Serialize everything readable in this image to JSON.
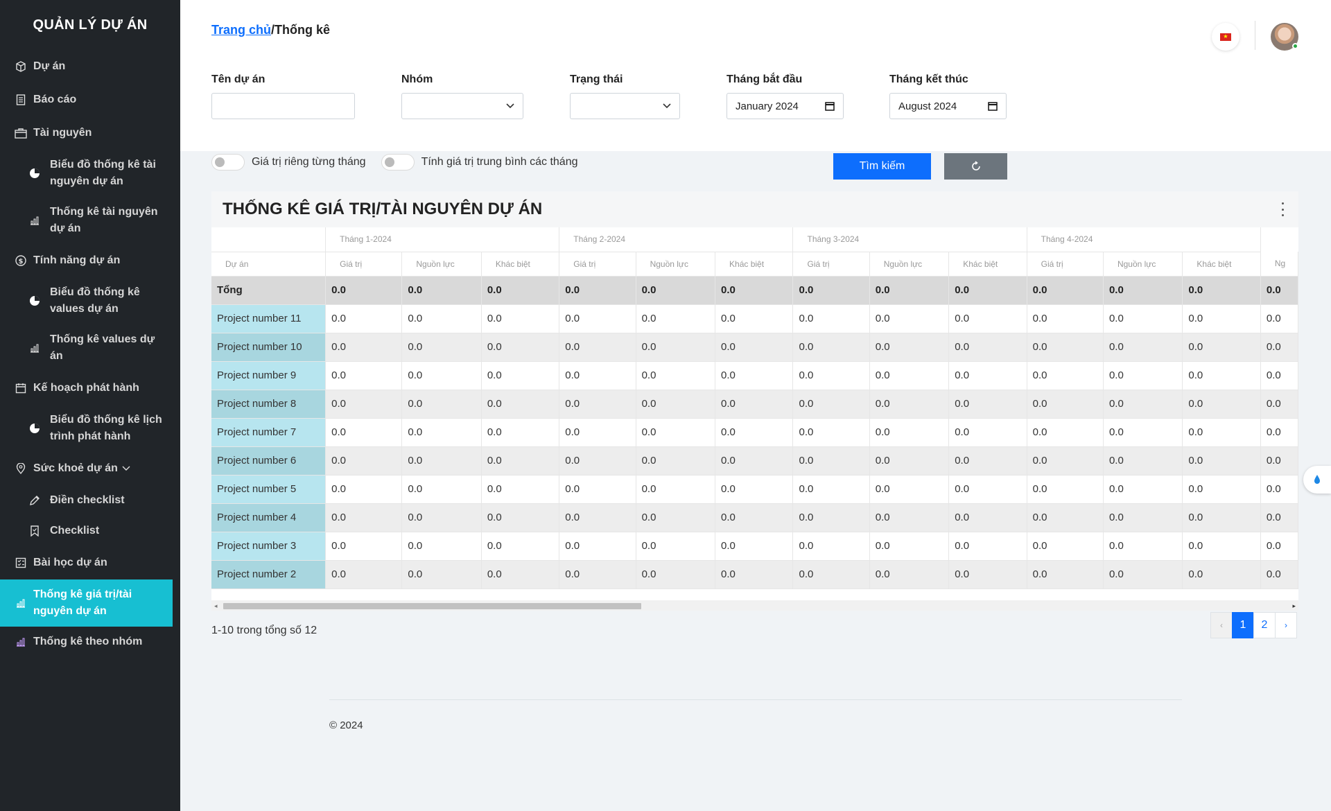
{
  "sidebar": {
    "brand": "QUẢN LÝ DỰ ÁN",
    "items": [
      {
        "label": "Dự án",
        "icon": "cube-icon"
      },
      {
        "label": "Báo cáo",
        "icon": "document-icon"
      },
      {
        "label": "Tài nguyên",
        "icon": "box-icon"
      },
      {
        "label": "Biểu đồ thống kê tài nguyên dự án",
        "icon": "pie-chart-icon"
      },
      {
        "label": "Thống kê tài nguyên dự án",
        "icon": "bar-chart-icon"
      },
      {
        "label": "Tính năng dự án",
        "icon": "dollar-circle-icon"
      },
      {
        "label": "Biểu đồ thống kê values dự án",
        "icon": "pie-chart-icon"
      },
      {
        "label": "Thống kê values dự án",
        "icon": "bar-chart-icon"
      },
      {
        "label": "Kế hoạch phát hành",
        "icon": "calendar-icon"
      },
      {
        "label": "Biểu đồ thống kê lịch trình phát hành",
        "icon": "pie-chart-icon"
      },
      {
        "label": "Sức khoẻ dự án",
        "icon": "location-pin-icon"
      },
      {
        "label": "Điền checklist",
        "icon": "pencil-icon"
      },
      {
        "label": "Checklist",
        "icon": "bookmark-icon"
      },
      {
        "label": "Bài học dự án",
        "icon": "checklist-icon"
      },
      {
        "label": "Thống kê giá trị/tài nguyên dự án",
        "icon": "bar-chart-icon"
      },
      {
        "label": "Thống kê theo nhóm",
        "icon": "bar-chart-icon"
      }
    ]
  },
  "breadcrumb": {
    "home": "Trang chủ",
    "separator": "/",
    "current": "Thống kê"
  },
  "filters": {
    "project_name": {
      "label": "Tên dự án",
      "value": ""
    },
    "group": {
      "label": "Nhóm",
      "value": ""
    },
    "status": {
      "label": "Trạng thái",
      "value": ""
    },
    "start_month": {
      "label": "Tháng bắt đầu",
      "value": "January 2024"
    },
    "end_month": {
      "label": "Tháng kết thúc",
      "value": "August 2024"
    }
  },
  "toggles": {
    "per_month": "Giá trị riêng từng tháng",
    "average": "Tính giá trị trung bình các tháng"
  },
  "buttons": {
    "search": "Tìm kiếm"
  },
  "card": {
    "title": "THỐNG KÊ GIÁ TRỊ/TÀI NGUYÊN DỰ ÁN"
  },
  "table": {
    "project_col": "Dự án",
    "months": [
      "Tháng 1-2024",
      "Tháng 2-2024",
      "Tháng 3-2024",
      "Tháng 4-2024"
    ],
    "metrics": [
      "Giá trị",
      "Nguồn lực",
      "Khác biệt"
    ],
    "visible_partial_header": "Ng",
    "total_label": "Tổng",
    "rows": [
      "Project number 11",
      "Project number 10",
      "Project number 9",
      "Project number 8",
      "Project number 7",
      "Project number 6",
      "Project number 5",
      "Project number 4",
      "Project number 3",
      "Project number 2"
    ],
    "cell_value": "0.0"
  },
  "pagination": {
    "info": "1-10 trong tổng số 12",
    "prev": "‹",
    "next": "›",
    "pages": [
      "1",
      "2"
    ],
    "current": "1"
  },
  "footer": {
    "copyright": "© 2024"
  }
}
